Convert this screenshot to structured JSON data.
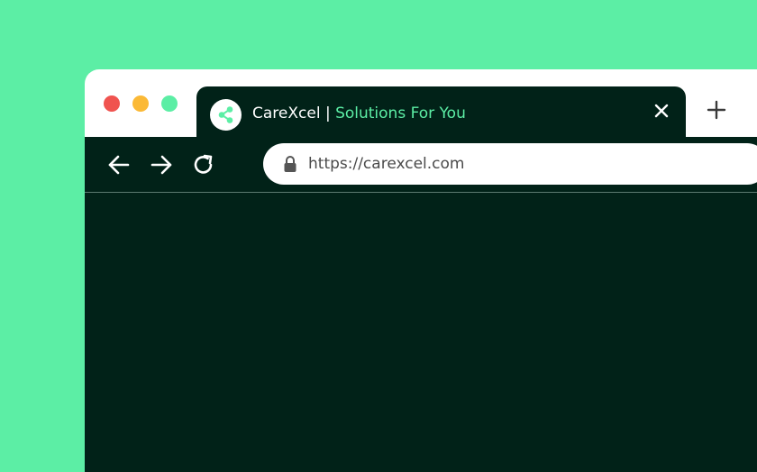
{
  "window_controls": {
    "close_color": "#f0534f",
    "minimize_color": "#fbb936",
    "maximize_color": "#5ceea5"
  },
  "tab": {
    "title_brand": "CareXcel |",
    "title_tagline": "Solutions For You",
    "logo_icon": "share-nodes-icon",
    "close_icon": "close-icon"
  },
  "new_tab": {
    "icon": "plus-icon"
  },
  "toolbar": {
    "back_icon": "arrow-left-icon",
    "forward_icon": "arrow-right-icon",
    "reload_icon": "reload-icon"
  },
  "address_bar": {
    "lock_icon": "lock-icon",
    "url": "https://carexcel.com"
  },
  "colors": {
    "background": "#5ceea5",
    "browser_dark": "#012218",
    "accent": "#5ceea5"
  }
}
